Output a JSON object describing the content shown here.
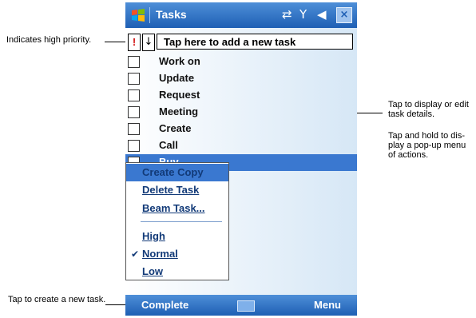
{
  "callouts": {
    "high_priority": "Indicates high priority.",
    "display_details": "Tap to display or edit task details.",
    "hold_menu": "Tap and hold to dis-play a pop-up menu of actions.",
    "create_task": "Tap to create a new task."
  },
  "titlebar": {
    "title": "Tasks",
    "icons": [
      "windows-start-icon",
      "sync-icon",
      "signal-icon",
      "speaker-icon",
      "close-icon"
    ]
  },
  "entry_bar": {
    "priority_glyph": "!",
    "sort_glyph": "↓",
    "add_task_text": "Tap here to add a new task"
  },
  "tasks": [
    {
      "name": "Work on",
      "checked": false,
      "selected": false
    },
    {
      "name": "Update",
      "checked": false,
      "selected": false
    },
    {
      "name": "Request",
      "checked": false,
      "selected": false
    },
    {
      "name": "Meeting",
      "checked": false,
      "selected": false
    },
    {
      "name": "Create",
      "checked": false,
      "selected": false
    },
    {
      "name": "Call",
      "checked": false,
      "selected": false
    },
    {
      "name": "Buy",
      "checked": false,
      "selected": true
    }
  ],
  "context_menu": {
    "items": [
      "Create Copy",
      "Delete Task",
      "Beam Task..."
    ],
    "priorities": [
      "High",
      "Normal",
      "Low"
    ],
    "checked_priority": "Normal"
  },
  "softkeys": {
    "left": "Complete",
    "right": "Menu"
  },
  "colors": {
    "titlebar": "#1e5fb4",
    "selection": "#3a78d0",
    "priority_mark": "#d21010"
  }
}
